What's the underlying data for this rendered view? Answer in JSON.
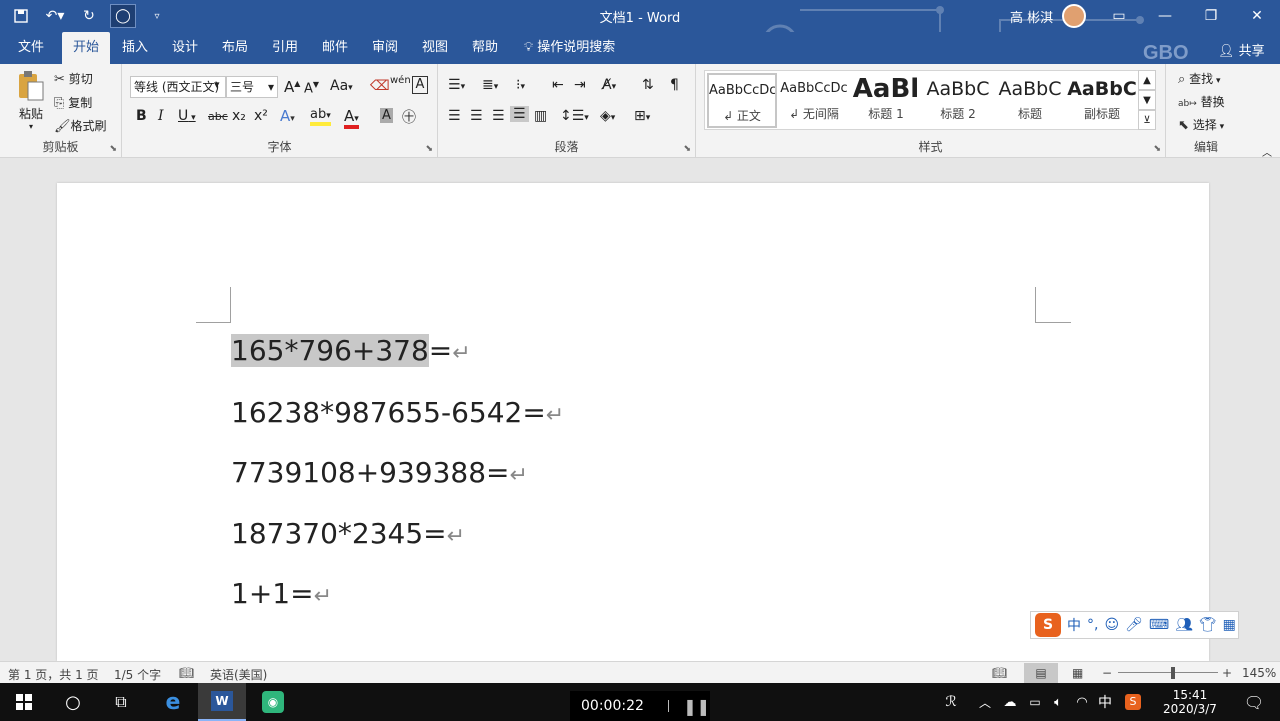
{
  "titlebar": {
    "title": "文档1  -  Word",
    "user": "高 彬淇",
    "qat": [
      "save-icon",
      "undo-icon",
      "redo-icon",
      "circle-icon",
      "customize-icon"
    ]
  },
  "tabs": [
    "文件",
    "开始",
    "插入",
    "设计",
    "布局",
    "引用",
    "邮件",
    "审阅",
    "视图",
    "帮助"
  ],
  "active_tab": "开始",
  "tell_me": "操作说明搜索",
  "watermark": "GBO",
  "share": "共享",
  "clipboard": {
    "paste": "粘贴",
    "cut": "剪切",
    "copy": "复制",
    "format_painter": "格式刷",
    "label": "剪贴板"
  },
  "font": {
    "name": "等线 (西文正文)",
    "size": "三号",
    "label": "字体",
    "grow": "A",
    "shrink": "A",
    "case": "Aa",
    "bold": "B",
    "italic": "I",
    "underline": "U",
    "strike": "abc",
    "sub": "x₂",
    "sup": "x²",
    "phonetic": "wén"
  },
  "paragraph": {
    "label": "段落"
  },
  "styles": {
    "label": "样式",
    "items": [
      {
        "preview": "AaBbCcDc",
        "name": "↲ 正文"
      },
      {
        "preview": "AaBbCcDc",
        "name": "↲ 无间隔"
      },
      {
        "preview": "AaBl",
        "name": "标题 1"
      },
      {
        "preview": "AaBbC",
        "name": "标题 2"
      },
      {
        "preview": "AaBbC",
        "name": "标题"
      },
      {
        "preview": "AaBbC",
        "name": "副标题"
      }
    ]
  },
  "editing": {
    "find": "查找",
    "replace": "替换",
    "select": "选择",
    "label": "编辑"
  },
  "document": {
    "lines": [
      {
        "sel": "165*796+378",
        "rest": "="
      },
      {
        "sel": "",
        "rest": "16238*987655-6542="
      },
      {
        "sel": "",
        "rest": "7739108+939388="
      },
      {
        "sel": "",
        "rest": "187370*2345="
      },
      {
        "sel": "",
        "rest": "1+1="
      }
    ],
    "para_mark": "↵"
  },
  "ime": {
    "logo": "S",
    "items": [
      "中",
      "°,",
      "☺",
      "🎤",
      "⌨",
      "👥",
      "👕",
      "▦"
    ]
  },
  "status": {
    "page": "第 1 页，共 1 页",
    "words": "1/5 个字",
    "lang": "英语(美国)",
    "zoom": "145%"
  },
  "taskbar": {
    "recorder_time": "00:00:22",
    "clock_time": "15:41",
    "clock_date": "2020/3/7",
    "ime": "中"
  }
}
